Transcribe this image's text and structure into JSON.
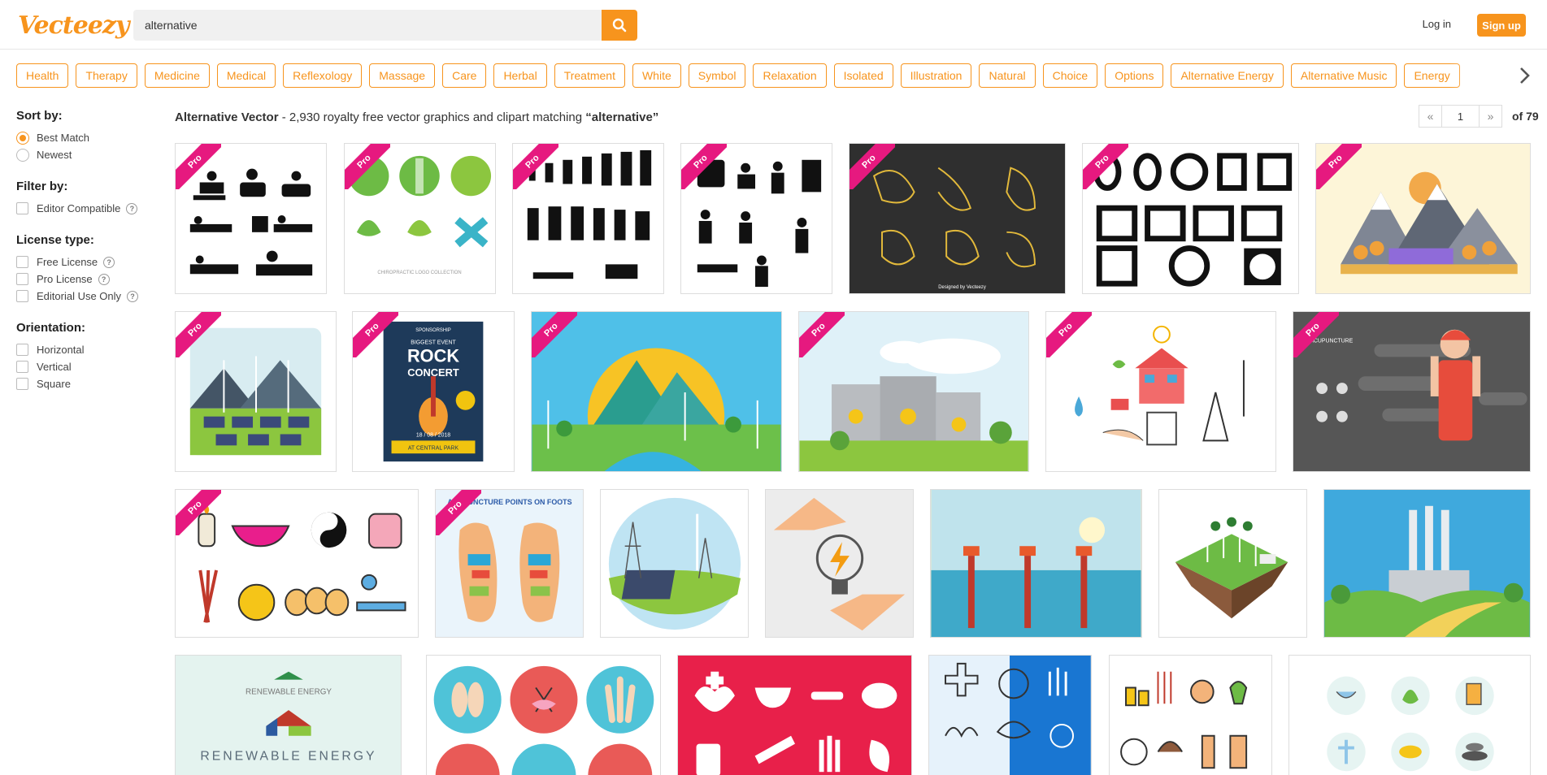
{
  "header": {
    "logo": "Vecteezy",
    "search_value": "alternative",
    "search_icon": "search-icon",
    "login_label": "Log in",
    "signup_label": "Sign up"
  },
  "tags": [
    "Health",
    "Therapy",
    "Medicine",
    "Medical",
    "Reflexology",
    "Massage",
    "Care",
    "Herbal",
    "Treatment",
    "White",
    "Symbol",
    "Relaxation",
    "Isolated",
    "Illustration",
    "Natural",
    "Choice",
    "Options",
    "Alternative Energy",
    "Alternative Music",
    "Energy"
  ],
  "sidebar": {
    "sort": {
      "title": "Sort by:",
      "options": [
        {
          "label": "Best Match",
          "selected": true
        },
        {
          "label": "Newest",
          "selected": false
        }
      ]
    },
    "filter": {
      "title": "Filter by:",
      "options": [
        {
          "label": "Editor Compatible"
        }
      ]
    },
    "license": {
      "title": "License type:",
      "options": [
        {
          "label": "Free License"
        },
        {
          "label": "Pro License"
        },
        {
          "label": "Editorial Use Only"
        }
      ]
    },
    "orientation": {
      "title": "Orientation:",
      "options": [
        {
          "label": "Horizontal"
        },
        {
          "label": "Vertical"
        },
        {
          "label": "Square"
        }
      ]
    }
  },
  "results": {
    "heading": "Alternative Vector",
    "summary_prefix": " - 2,930 royalty free vector graphics and clipart matching ",
    "query_quoted": "“alternative”"
  },
  "pagination": {
    "prev": "«",
    "current_page": "1",
    "next": "»",
    "of_label": "of 79"
  },
  "pro_label": "Pro",
  "tile_text": {
    "chiro_logo": "CHIROPRACTIC LOGO COLLECTION",
    "designed_by": "Designed by Vecteezy",
    "rock_small": "SPONSORSHIP",
    "rock_event": "BIGGEST EVENT",
    "rock_title": "ROCK",
    "rock_sub": "CONCERT",
    "rock_date": "18 / 08 / 2018",
    "rock_venue": "AT CENTRAL PARK",
    "acupuncture": "ACUPUNCTURE",
    "foot_points": "ACUPUNCTURE POINTS ON FOOTS",
    "renewable_small": "RENEWABLE ENERGY",
    "renewable_big": "RENEWABLE ENERGY"
  },
  "colors": {
    "accent": "#f7941d",
    "pro_ribbon": "#e6197f"
  }
}
